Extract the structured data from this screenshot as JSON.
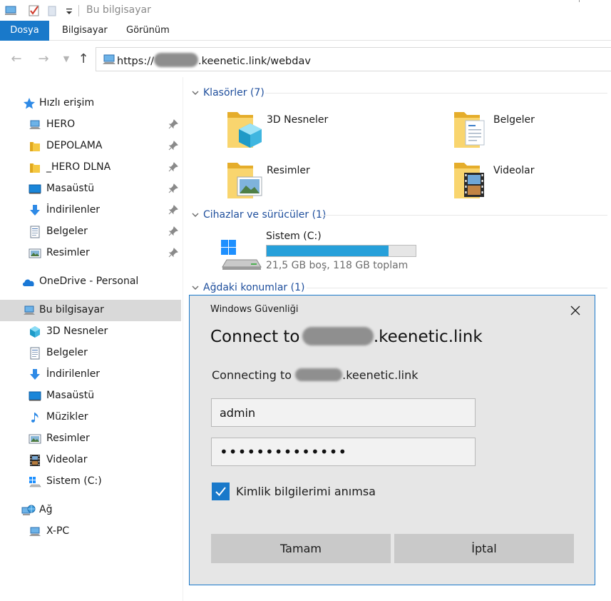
{
  "window": {
    "title": "Bu bilgisayar"
  },
  "ribbon": {
    "tabs": [
      "Dosya",
      "Bilgisayar",
      "Görünüm"
    ]
  },
  "address": {
    "prefix": "https://",
    "suffix": ".keenetic.link/webdav"
  },
  "nav": {
    "quick_access": "Hızlı erişim",
    "pinned": [
      "HERO",
      "DEPOLAMA",
      "_HERO DLNA",
      "Masaüstü",
      "İndirilenler",
      "Belgeler",
      "Resimler"
    ],
    "onedrive": "OneDrive - Personal",
    "this_pc": "Bu bilgisayar",
    "this_pc_items": [
      "3D Nesneler",
      "Belgeler",
      "İndirilenler",
      "Masaüstü",
      "Müzikler",
      "Resimler",
      "Videolar",
      "Sistem (C:)"
    ],
    "network": "Ağ",
    "network_items": [
      "X-PC"
    ]
  },
  "content": {
    "folders_header": "Klasörler (7)",
    "folders": [
      "3D Nesneler",
      "Belgeler",
      "Resimler",
      "Videolar"
    ],
    "devices_header": "Cihazlar ve sürücüler (1)",
    "drive": {
      "name": "Sistem (C:)",
      "free_text": "21,5 GB boş, 118 GB toplam",
      "used_fraction": 0.818
    },
    "network_header": "Ağdaki konumlar (1)"
  },
  "dialog": {
    "caption": "Windows Güvenliği",
    "title_prefix": "Connect to ",
    "title_suffix": ".keenetic.link",
    "sub_prefix": "Connecting to ",
    "sub_suffix": ".keenetic.link",
    "username": "admin",
    "password": "••••••••••••••",
    "remember_label": "Kimlik bilgilerimi anımsa",
    "ok_label": "Tamam",
    "cancel_label": "İptal"
  },
  "colors": {
    "accent": "#1979ca",
    "drive_fill": "#26a0da",
    "header_blue": "#1e4e9c",
    "folder_yellow": "#f5c842"
  }
}
